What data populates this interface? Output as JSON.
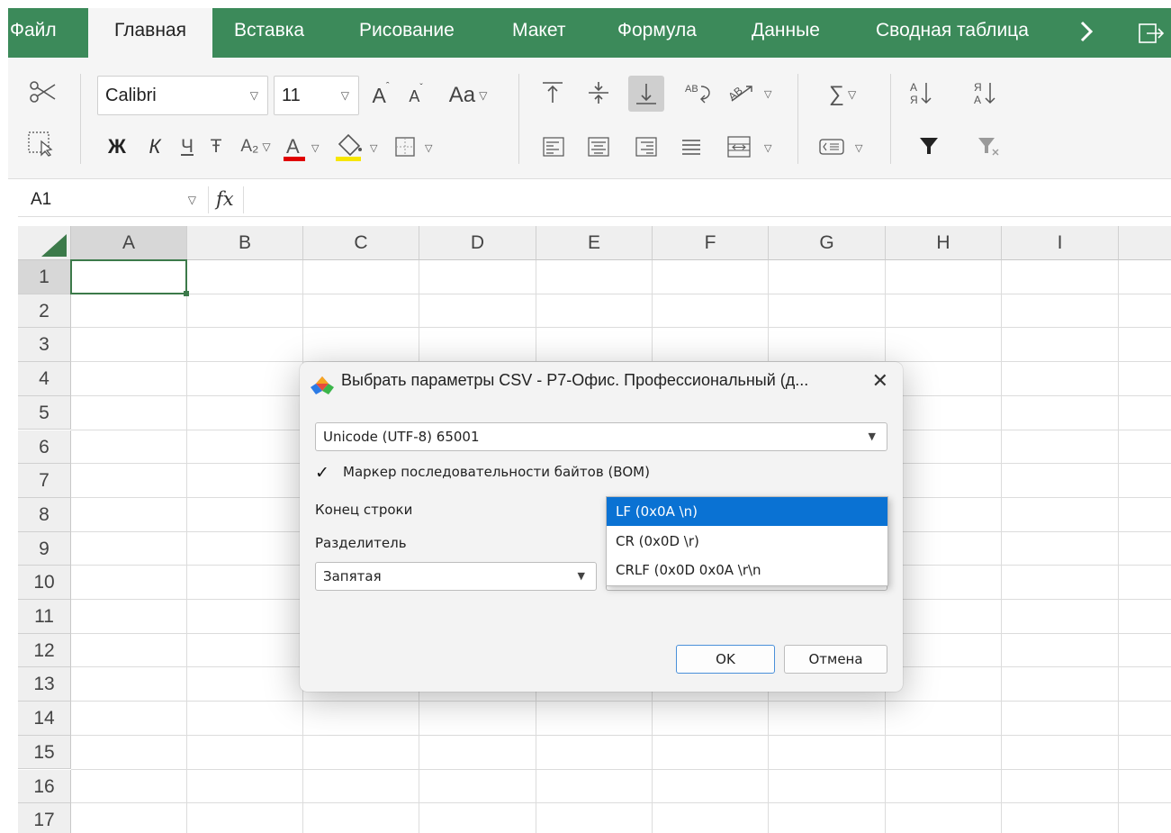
{
  "ribbon": {
    "tabs": [
      {
        "label": "Файл",
        "active": false
      },
      {
        "label": "Главная",
        "active": true
      },
      {
        "label": "Вставка",
        "active": false
      },
      {
        "label": "Рисование",
        "active": false
      },
      {
        "label": "Макет",
        "active": false
      },
      {
        "label": "Формула",
        "active": false
      },
      {
        "label": "Данные",
        "active": false
      },
      {
        "label": "Сводная таблица",
        "active": false
      }
    ],
    "accent_color": "#3c8a5a"
  },
  "toolbar": {
    "font_name": "Calibri",
    "font_size": "11",
    "grow_font_glyph": "A",
    "shrink_font_glyph": "A",
    "change_case_label": "Aa",
    "bold_label": "Ж",
    "italic_label": "К",
    "underline_label": "Ч",
    "strike_label": "Ŧ",
    "subscript_label": "A₂",
    "font_color": "#e00000",
    "fill_color": "#f7e600",
    "sum_label": "∑"
  },
  "formula_bar": {
    "cell_ref": "A1",
    "fx_label": "fx",
    "value": ""
  },
  "grid": {
    "columns": [
      "A",
      "B",
      "C",
      "D",
      "E",
      "F",
      "G",
      "H",
      "I"
    ],
    "rows": [
      "1",
      "2",
      "3",
      "4",
      "5",
      "6",
      "7",
      "8",
      "9",
      "10",
      "11",
      "12",
      "13",
      "14",
      "15",
      "16",
      "17"
    ],
    "selected_cell": "A1",
    "selection_color": "#3c7a4a"
  },
  "dialog": {
    "title": "Выбрать параметры CSV - Р7-Офис. Профессиональный (д...",
    "encoding_value": "Unicode (UTF-8) 65001",
    "bom_label": "Маркер последовательности байтов (BOM)",
    "bom_checked": true,
    "line_end_label": "Конец строки",
    "delimiter_label": "Разделитель",
    "delimiter_value": "Запятая",
    "line_end_options": [
      "LF (0x0A \\n)",
      "CR (0x0D \\r)",
      "CRLF (0x0D 0x0A \\r\\n"
    ],
    "highlighted_option": "LF (0x0A \\n)",
    "ok_label": "OK",
    "cancel_label": "Отмена"
  }
}
